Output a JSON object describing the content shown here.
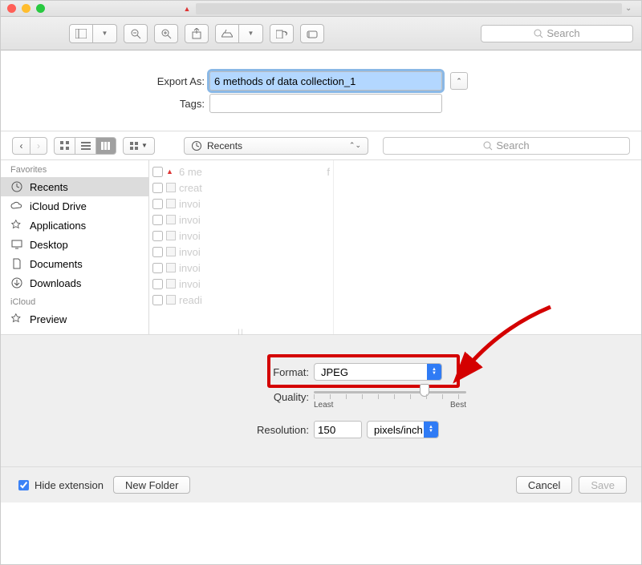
{
  "title": {
    "pdf_icon": "pdf-icon",
    "caret": "⌄"
  },
  "toolbar": {
    "search_placeholder": "Search"
  },
  "export": {
    "export_label": "Export As:",
    "filename": "6 methods of data collection_1",
    "tags_label": "Tags:",
    "tags_value": ""
  },
  "nav": {
    "location": "Recents",
    "search_placeholder": "Search"
  },
  "sidebar": {
    "favorites_header": "Favorites",
    "icloud_header": "iCloud",
    "items": [
      {
        "label": "Recents",
        "icon": "clock-icon"
      },
      {
        "label": "iCloud Drive",
        "icon": "cloud-icon"
      },
      {
        "label": "Applications",
        "icon": "app-icon"
      },
      {
        "label": "Desktop",
        "icon": "desktop-icon"
      },
      {
        "label": "Documents",
        "icon": "doc-icon"
      },
      {
        "label": "Downloads",
        "icon": "download-icon"
      }
    ],
    "icloud_items": [
      {
        "label": "Preview",
        "icon": "preview-icon"
      }
    ]
  },
  "files": [
    {
      "name": "6 me",
      "suffix": "f",
      "pdf": true
    },
    {
      "name": "creat",
      "pdf": false
    },
    {
      "name": "invoi",
      "pdf": false
    },
    {
      "name": "invoi",
      "pdf": false
    },
    {
      "name": "invoi",
      "pdf": false
    },
    {
      "name": "invoi",
      "pdf": false
    },
    {
      "name": "invoi",
      "pdf": false
    },
    {
      "name": "invoi",
      "pdf": false
    },
    {
      "name": "readi",
      "pdf": false
    }
  ],
  "options": {
    "format_label": "Format:",
    "format_value": "JPEG",
    "quality_label": "Quality:",
    "quality_least": "Least",
    "quality_best": "Best",
    "resolution_label": "Resolution:",
    "resolution_value": "150",
    "resolution_unit": "pixels/inch"
  },
  "footer": {
    "hide_ext": "Hide extension",
    "new_folder": "New Folder",
    "cancel": "Cancel",
    "save": "Save"
  }
}
